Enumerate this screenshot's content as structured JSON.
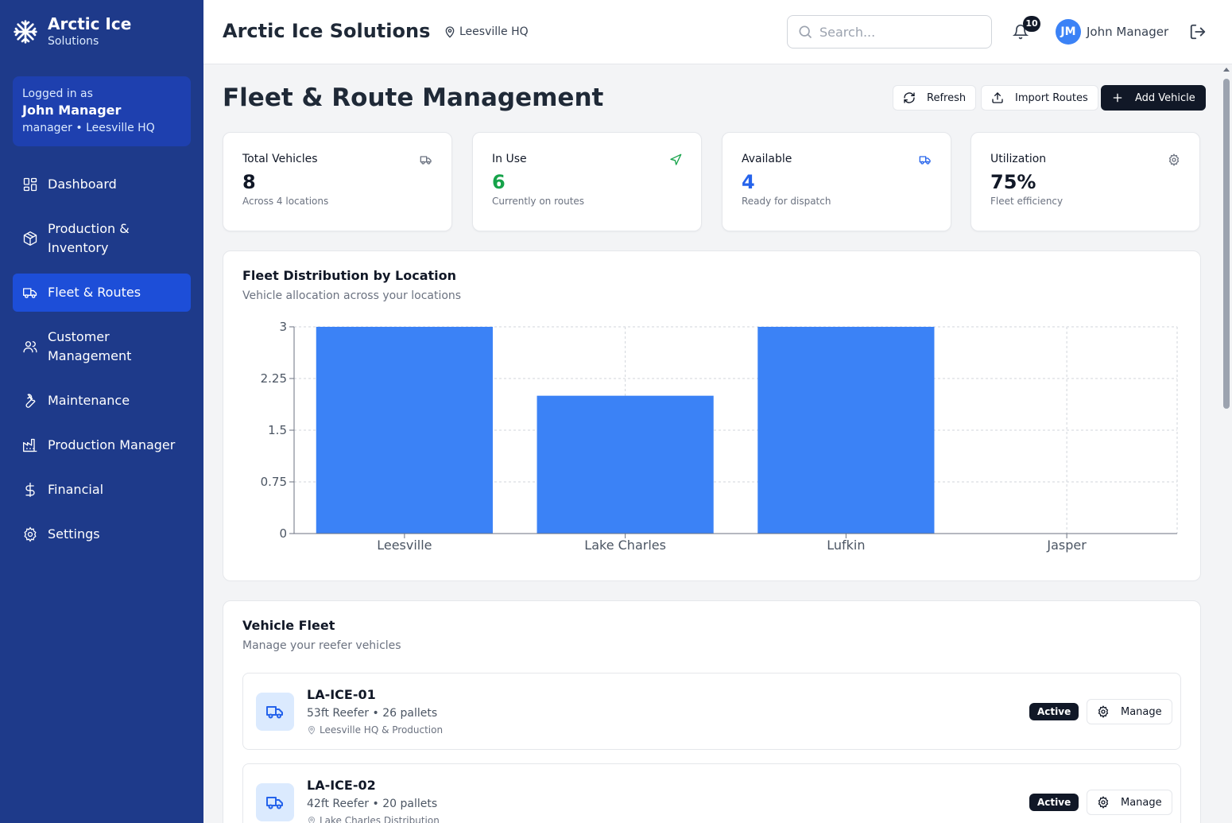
{
  "brand": {
    "title": "Arctic Ice",
    "subtitle": "Solutions"
  },
  "user_box": {
    "logged_in_label": "Logged in as",
    "name": "John Manager",
    "role_location": "manager • Leesville HQ"
  },
  "sidebar": {
    "items": [
      {
        "label": "Dashboard",
        "icon": "dashboard-icon",
        "active": false
      },
      {
        "label": "Production & Inventory",
        "icon": "box-icon",
        "active": false
      },
      {
        "label": "Fleet & Routes",
        "icon": "truck-icon",
        "active": true
      },
      {
        "label": "Customer Management",
        "icon": "users-icon",
        "active": false
      },
      {
        "label": "Maintenance",
        "icon": "wrench-icon",
        "active": false
      },
      {
        "label": "Production Manager",
        "icon": "factory-icon",
        "active": false
      },
      {
        "label": "Financial",
        "icon": "dollar-icon",
        "active": false
      },
      {
        "label": "Settings",
        "icon": "gear-icon",
        "active": false
      }
    ]
  },
  "header": {
    "title": "Arctic Ice Solutions",
    "location": "Leesville HQ",
    "search_placeholder": "Search...",
    "notification_count": "10",
    "user_initials": "JM",
    "user_name": "John Manager"
  },
  "page": {
    "title": "Fleet & Route Management",
    "buttons": {
      "refresh": "Refresh",
      "import": "Import Routes",
      "add": "Add Vehicle"
    }
  },
  "stats": [
    {
      "label": "Total Vehicles",
      "value": "8",
      "sub": "Across 4 locations",
      "color": "#111827",
      "icon": "truck-icon"
    },
    {
      "label": "In Use",
      "value": "6",
      "sub": "Currently on routes",
      "color": "#16a34a",
      "icon": "navigation-icon"
    },
    {
      "label": "Available",
      "value": "4",
      "sub": "Ready for dispatch",
      "color": "#2563eb",
      "icon": "truck-icon"
    },
    {
      "label": "Utilization",
      "value": "75%",
      "sub": "Fleet efficiency",
      "color": "#111827",
      "icon": "gear-icon"
    }
  ],
  "chart_card": {
    "title": "Fleet Distribution by Location",
    "subtitle": "Vehicle allocation across your locations"
  },
  "chart_data": {
    "type": "bar",
    "categories": [
      "Leesville",
      "Lake Charles",
      "Lufkin",
      "Jasper"
    ],
    "values": [
      3,
      2,
      3,
      0
    ],
    "ylim": [
      0,
      3
    ],
    "yticks": [
      "0",
      "0.75",
      "1.5",
      "2.25",
      "3"
    ],
    "grid": true,
    "bar_color": "#3b82f6",
    "title": "",
    "xlabel": "",
    "ylabel": ""
  },
  "fleet_card": {
    "title": "Vehicle Fleet",
    "subtitle": "Manage your reefer vehicles"
  },
  "vehicles": [
    {
      "id": "LA-ICE-01",
      "spec": "53ft Reefer • 26 pallets",
      "location": "Leesville HQ & Production",
      "status": "Active",
      "action": "Manage"
    },
    {
      "id": "LA-ICE-02",
      "spec": "42ft Reefer • 20 pallets",
      "location": "Lake Charles Distribution",
      "status": "Active",
      "action": "Manage"
    }
  ],
  "colors": {
    "sidebar": "#1e3a8a",
    "sidebar_active": "#1d4ed8",
    "accent": "#3b82f6"
  }
}
